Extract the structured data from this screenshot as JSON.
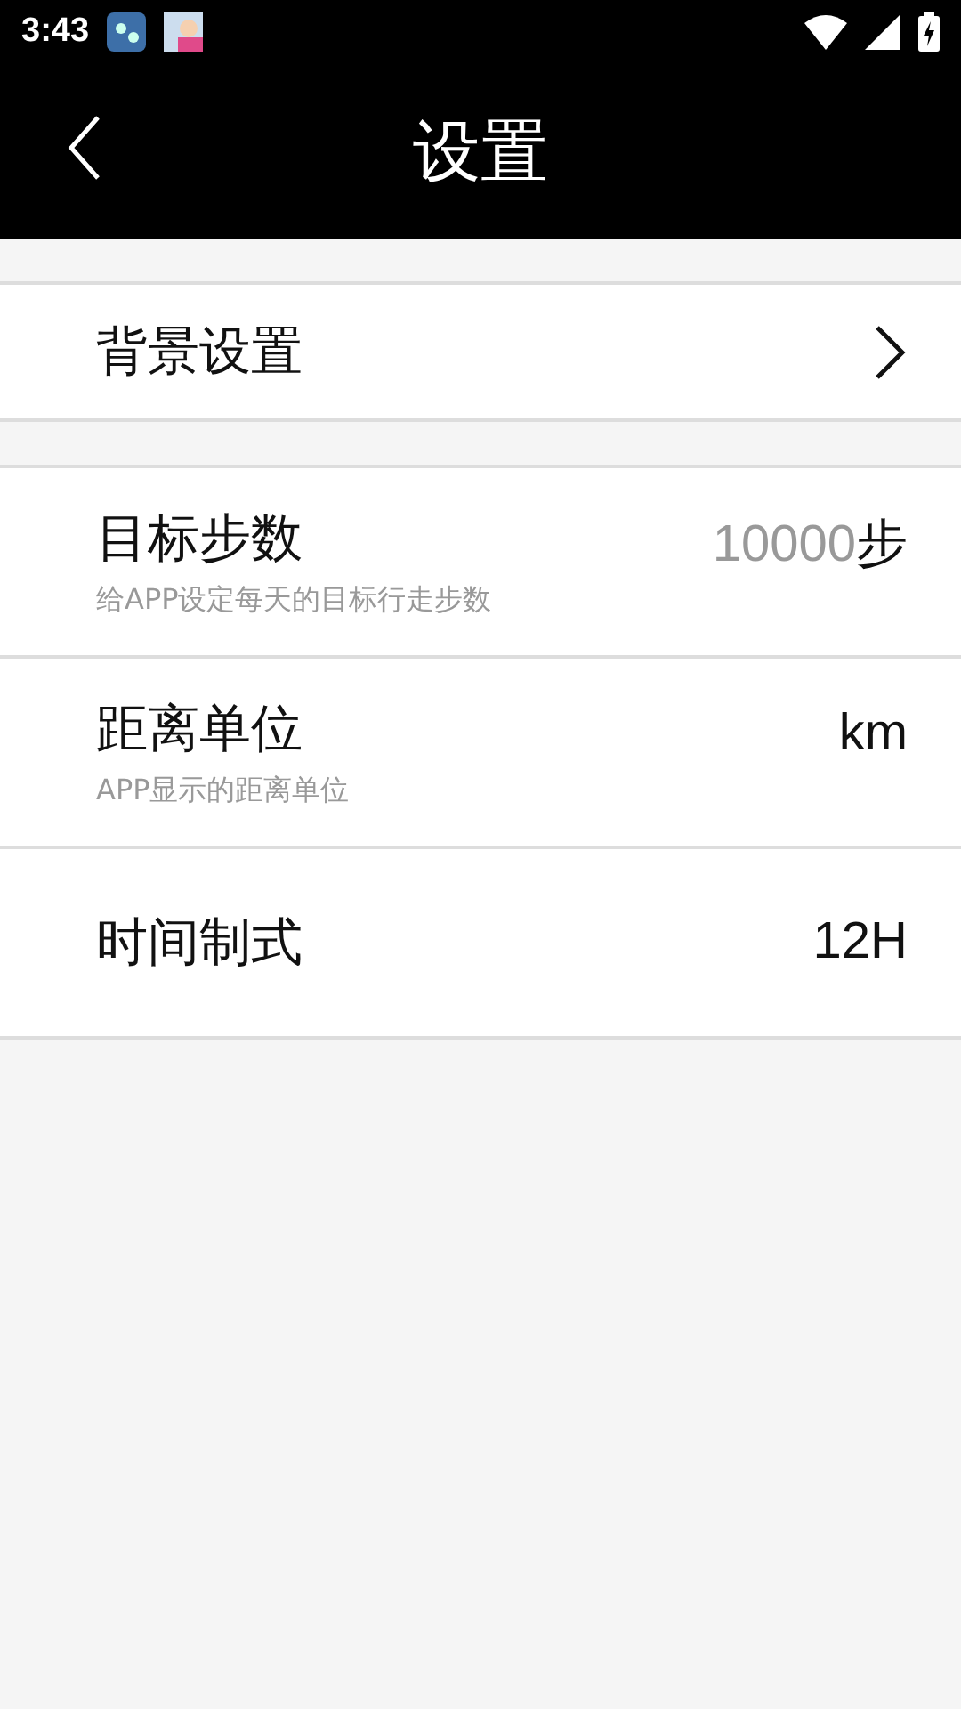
{
  "status_bar": {
    "time": "3:43"
  },
  "header": {
    "title": "设置"
  },
  "sections": [
    {
      "rows": [
        {
          "kind": "link",
          "label": "背景设置"
        }
      ]
    },
    {
      "rows": [
        {
          "kind": "value",
          "label": "目标步数",
          "hint": "给APP设定每天的目标行走步数",
          "value": "10000",
          "unit": "步"
        },
        {
          "kind": "value",
          "label": "距离单位",
          "hint": "APP显示的距离单位",
          "value": "km"
        },
        {
          "kind": "value",
          "label": "时间制式",
          "value": "12H"
        }
      ]
    }
  ]
}
